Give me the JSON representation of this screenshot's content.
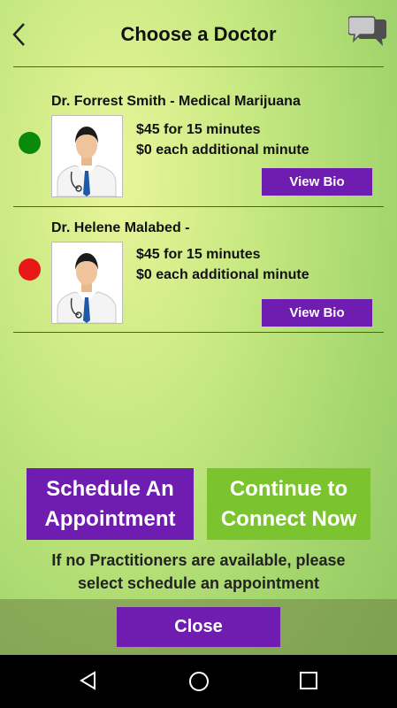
{
  "header": {
    "title": "Choose a Doctor",
    "back_icon": "chevron-left-icon",
    "chat_icon": "chat-bubbles-icon"
  },
  "doctors": [
    {
      "name": "Dr. Forrest Smith - Medical Marijuana",
      "status": "online",
      "status_color": "#0a8a0a",
      "price_line1": "$45 for 15 minutes",
      "price_line2": "$0 each additional minute",
      "bio_label": "View Bio"
    },
    {
      "name": "Dr. Helene Malabed -",
      "status": "offline",
      "status_color": "#e81818",
      "price_line1": "$45 for 15 minutes",
      "price_line2": "$0 each additional minute",
      "bio_label": "View Bio"
    }
  ],
  "actions": {
    "schedule_line1": "Schedule An",
    "schedule_line2": "Appointment",
    "connect_line1": "Continue to",
    "connect_line2": "Connect Now",
    "note_line1": "If no Practitioners are available, please",
    "note_line2": "select schedule an appointment",
    "close_label": "Close"
  },
  "colors": {
    "purple": "#6f1cb0",
    "green_button": "#7cc42f"
  },
  "system_nav": [
    "back-triangle-icon",
    "home-circle-icon",
    "recents-square-icon"
  ]
}
